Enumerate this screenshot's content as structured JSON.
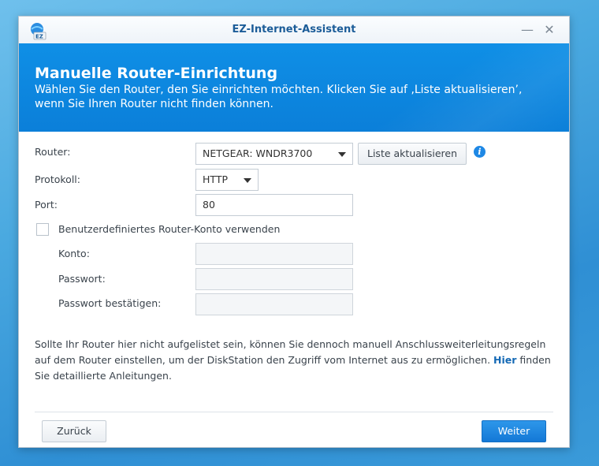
{
  "window": {
    "title": "EZ-Internet-Assistent",
    "minimize_glyph": "—",
    "close_glyph": "✕"
  },
  "icons": {
    "app": "ez-internet-icon",
    "info": "info-icon",
    "dropdown": "chevron-down-icon"
  },
  "colors": {
    "banner": "#0b84dc",
    "primary_button": "#1a82df",
    "title_text": "#1b5c98",
    "link": "#1469b5"
  },
  "header": {
    "title": "Manuelle Router-Einrichtung",
    "subtitle": "Wählen Sie den Router, den Sie einrichten möchten. Klicken Sie auf ‚Liste aktualisieren’, wenn Sie Ihren Router nicht finden können."
  },
  "form": {
    "router_label": "Router:",
    "router_value": "NETGEAR: WNDR3700",
    "refresh_button": "Liste aktualisieren",
    "protocol_label": "Protokoll:",
    "protocol_value": "HTTP",
    "port_label": "Port:",
    "port_value": "80",
    "custom_account_label": "Benutzerdefiniertes Router-Konto verwenden",
    "account_label": "Konto:",
    "password_label": "Passwort:",
    "password_confirm_label": "Passwort bestätigen:"
  },
  "note": {
    "text_before": "Sollte Ihr Router hier nicht aufgelistet sein, können Sie dennoch manuell Anschlussweiterleitungsregeln auf dem Router einstellen, um der DiskStation den Zugriff vom Internet aus zu ermöglichen. ",
    "link": "Hier",
    "text_after": " finden Sie detaillierte Anleitungen."
  },
  "footer": {
    "back_button": "Zurück",
    "next_button": "Weiter"
  }
}
